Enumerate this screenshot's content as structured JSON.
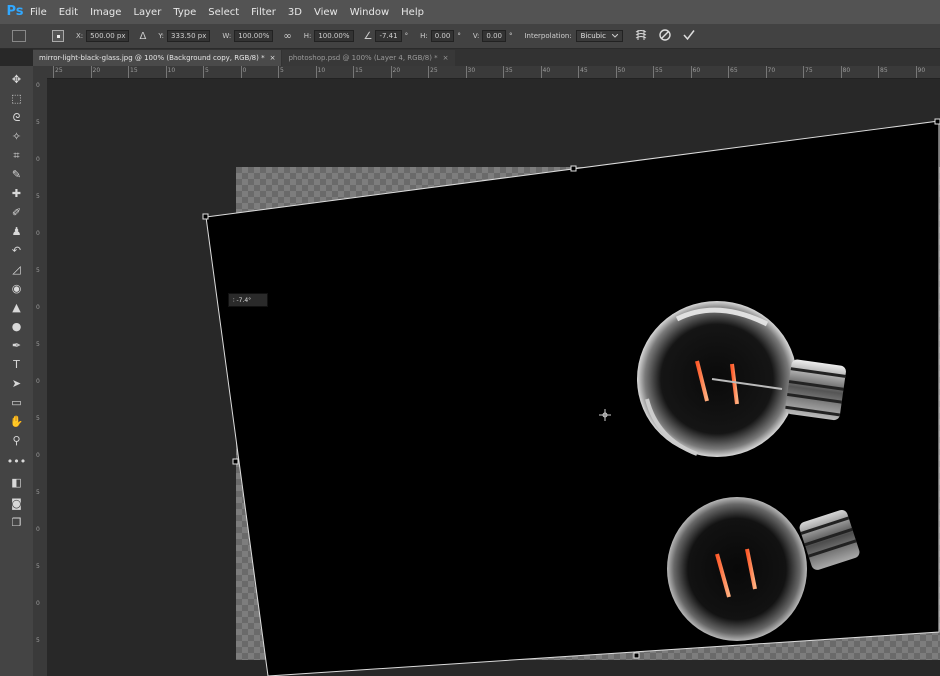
{
  "app": {
    "logo": "Ps"
  },
  "menu": [
    "File",
    "Edit",
    "Image",
    "Layer",
    "Type",
    "Select",
    "Filter",
    "3D",
    "View",
    "Window",
    "Help"
  ],
  "options": {
    "x_label": "X:",
    "x_value": "500.00 px",
    "delta_symbol": "Δ",
    "y_label": "Y:",
    "y_value": "333.50 px",
    "w_label": "W:",
    "w_value": "100.00%",
    "link_symbol": "∞",
    "h_label": "H:",
    "h_value": "100.00%",
    "angle_symbol": "∠",
    "angle_value": "-7.41",
    "angle_unit": "°",
    "hskew_label": "H:",
    "hskew_value": "0.00",
    "hskew_unit": "°",
    "vskew_label": "V:",
    "vskew_value": "0.00",
    "vskew_unit": "°",
    "interp_label": "Interpolation:",
    "interp_value": "Bicubic",
    "warp_icon": "warp-icon",
    "cancel_icon": "cancel-icon",
    "commit_icon": "checkmark-icon"
  },
  "tabs": [
    {
      "label": "mirror-light-black-glass.jpg @ 100% (Background copy, RGB/8) *",
      "close": "×",
      "active": true
    },
    {
      "label": "photoshop.psd @ 100% (Layer 4, RGB/8) *",
      "close": "×",
      "active": false
    }
  ],
  "ruler": {
    "h_ticks": [
      "25",
      "20",
      "15",
      "10",
      "5",
      "0",
      "5",
      "10",
      "15",
      "20",
      "25",
      "30",
      "35",
      "40",
      "45",
      "50",
      "55",
      "60",
      "65",
      "70",
      "75",
      "80",
      "85",
      "90"
    ],
    "v_ticks": [
      "0",
      "5",
      "0",
      "5",
      "0",
      "5",
      "0",
      "5",
      "0",
      "5",
      "0",
      "5",
      "0",
      "5",
      "0",
      "5"
    ]
  },
  "tools": [
    {
      "name": "move-tool-icon",
      "glyph": "✥"
    },
    {
      "name": "marquee-tool-icon",
      "glyph": "⬚"
    },
    {
      "name": "lasso-tool-icon",
      "glyph": "ᘓ"
    },
    {
      "name": "magic-wand-tool-icon",
      "glyph": "✧"
    },
    {
      "name": "crop-tool-icon",
      "glyph": "⌗"
    },
    {
      "name": "eyedropper-tool-icon",
      "glyph": "✎"
    },
    {
      "name": "healing-brush-tool-icon",
      "glyph": "✚"
    },
    {
      "name": "brush-tool-icon",
      "glyph": "✐"
    },
    {
      "name": "stamp-tool-icon",
      "glyph": "♟"
    },
    {
      "name": "history-brush-tool-icon",
      "glyph": "↶"
    },
    {
      "name": "eraser-tool-icon",
      "glyph": "◿"
    },
    {
      "name": "paint-bucket-tool-icon",
      "glyph": "◉"
    },
    {
      "name": "blur-tool-icon",
      "glyph": "▲"
    },
    {
      "name": "dodge-tool-icon",
      "glyph": "●"
    },
    {
      "name": "pen-tool-icon",
      "glyph": "✒"
    },
    {
      "name": "type-tool-icon",
      "glyph": "T"
    },
    {
      "name": "path-selection-tool-icon",
      "glyph": "➤"
    },
    {
      "name": "rectangle-tool-icon",
      "glyph": "▭"
    },
    {
      "name": "hand-tool-icon",
      "glyph": "✋"
    },
    {
      "name": "zoom-tool-icon",
      "glyph": "⚲"
    },
    {
      "name": "more-tools-icon",
      "glyph": "•••"
    },
    {
      "name": "color-swatches-icon",
      "glyph": "◧"
    },
    {
      "name": "quick-mask-icon",
      "glyph": "◙"
    },
    {
      "name": "screen-mode-icon",
      "glyph": "❐"
    }
  ],
  "canvas": {
    "rotation_readout": "∶ -7.4°"
  }
}
